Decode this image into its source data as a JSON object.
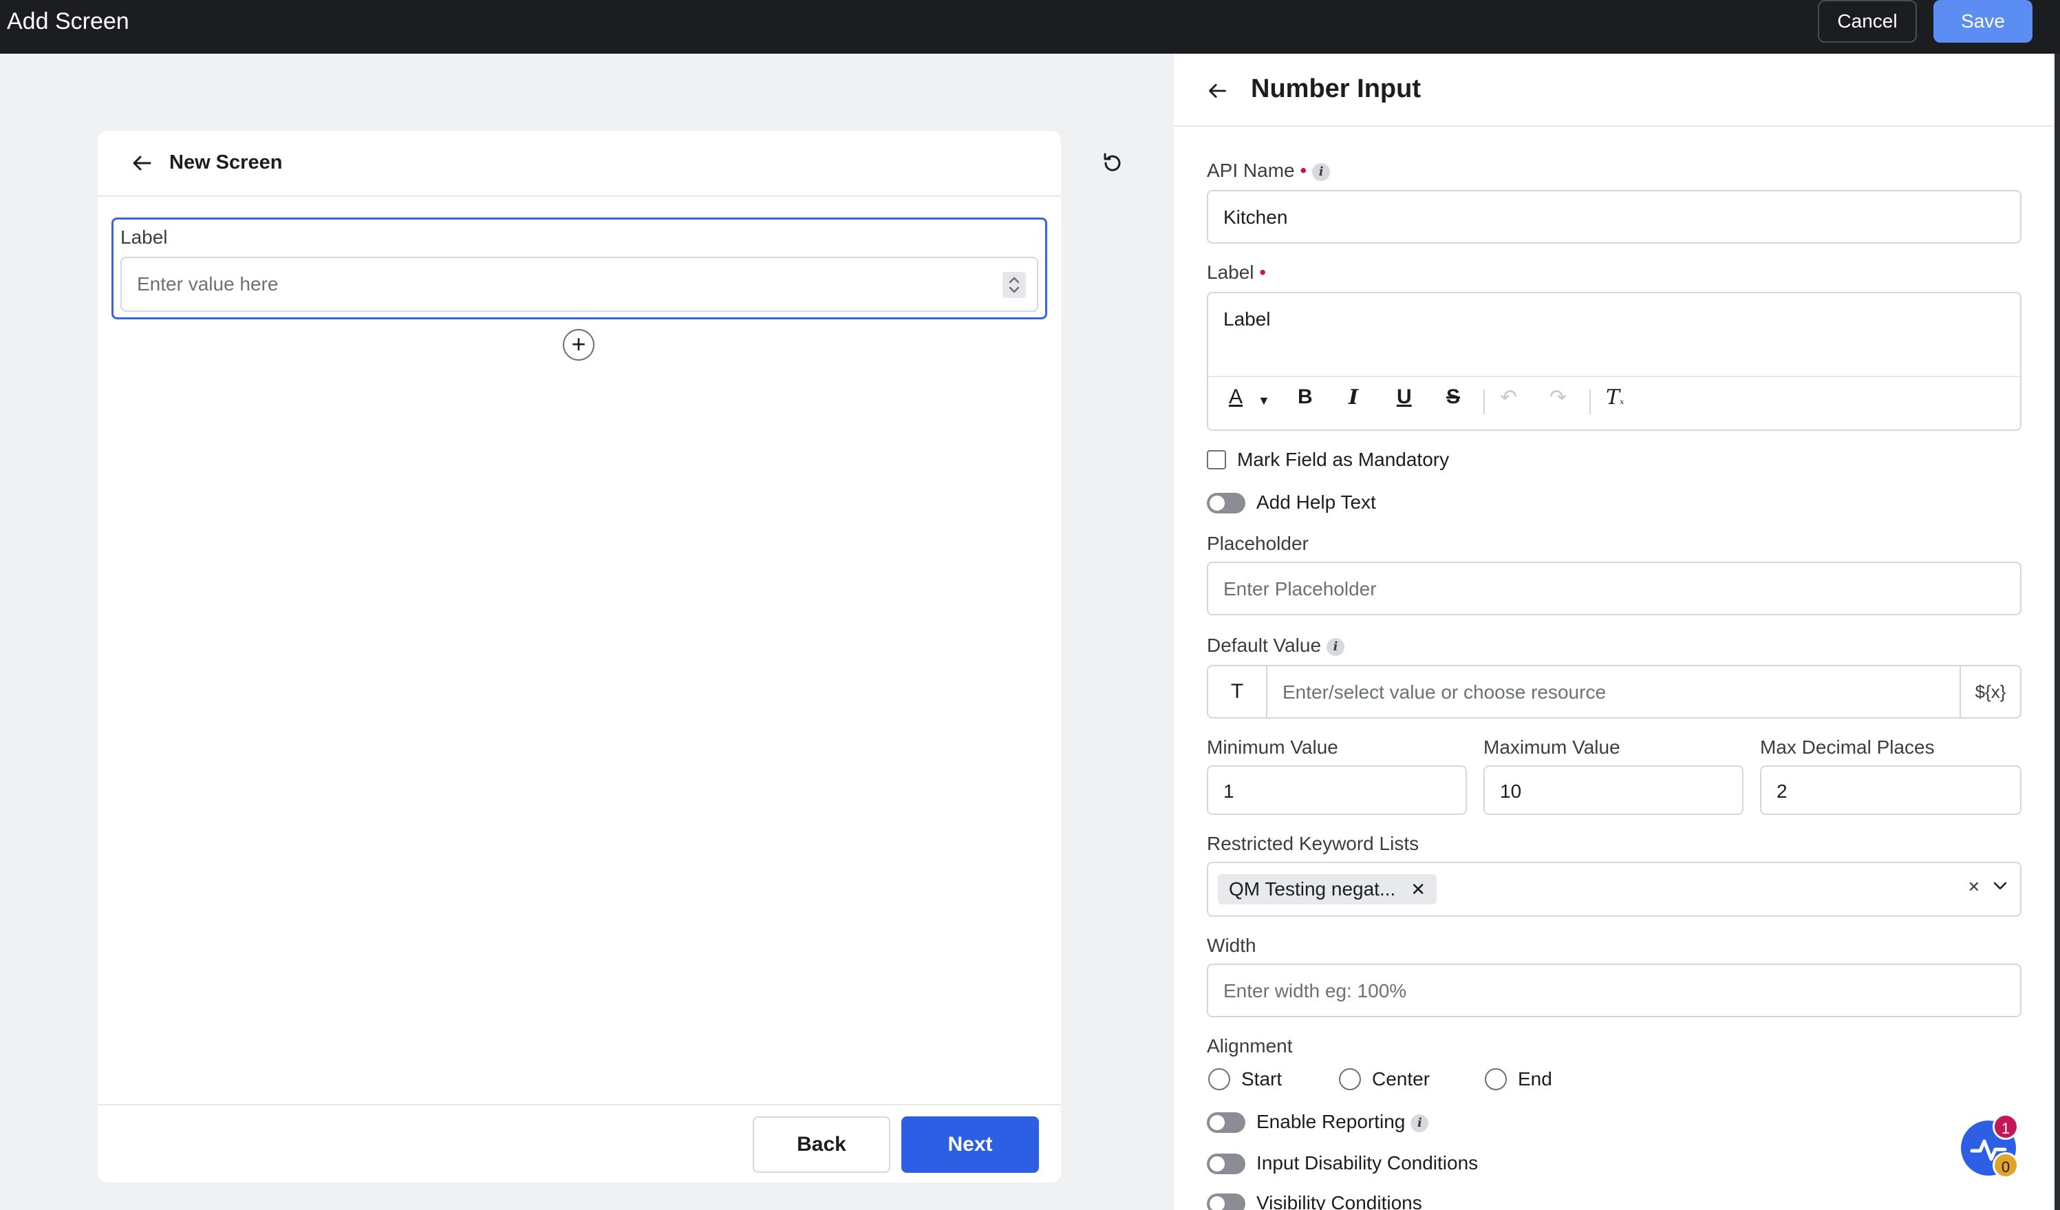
{
  "topbar": {
    "title": "Add Screen",
    "cancel": "Cancel",
    "save": "Save"
  },
  "canvas": {
    "title": "New Screen",
    "field_label": "Label",
    "field_placeholder": "Enter value here",
    "back": "Back",
    "next": "Next"
  },
  "panel": {
    "title": "Number Input",
    "api_name_label": "API Name",
    "api_name_value": "Kitchen",
    "label_label": "Label",
    "label_value": "Label",
    "mandatory_label": "Mark Field as Mandatory",
    "help_text_label": "Add Help Text",
    "placeholder_label": "Placeholder",
    "placeholder_placeholder": "Enter Placeholder",
    "default_value_label": "Default Value",
    "default_value_type": "T",
    "default_value_placeholder": "Enter/select value or choose resource",
    "resource_button": "${x}",
    "min_label": "Minimum Value",
    "min_value": "1",
    "max_label": "Maximum Value",
    "max_value": "10",
    "decimal_label": "Max Decimal Places",
    "decimal_value": "2",
    "restricted_label": "Restricted Keyword Lists",
    "restricted_tag": "QM Testing negat...",
    "width_label": "Width",
    "width_placeholder": "Enter width eg: 100%",
    "alignment_label": "Alignment",
    "alignment_options": [
      "Start",
      "Center",
      "End"
    ],
    "enable_reporting_label": "Enable Reporting",
    "input_disability_label": "Input Disability Conditions",
    "visibility_label": "Visibility Conditions"
  },
  "widget": {
    "red_count": "1",
    "yellow_count": "0"
  },
  "colors": {
    "accent": "#2c5fe3",
    "save": "#5b8df2",
    "topbar": "#1c1d21",
    "required": "#c2185b"
  }
}
